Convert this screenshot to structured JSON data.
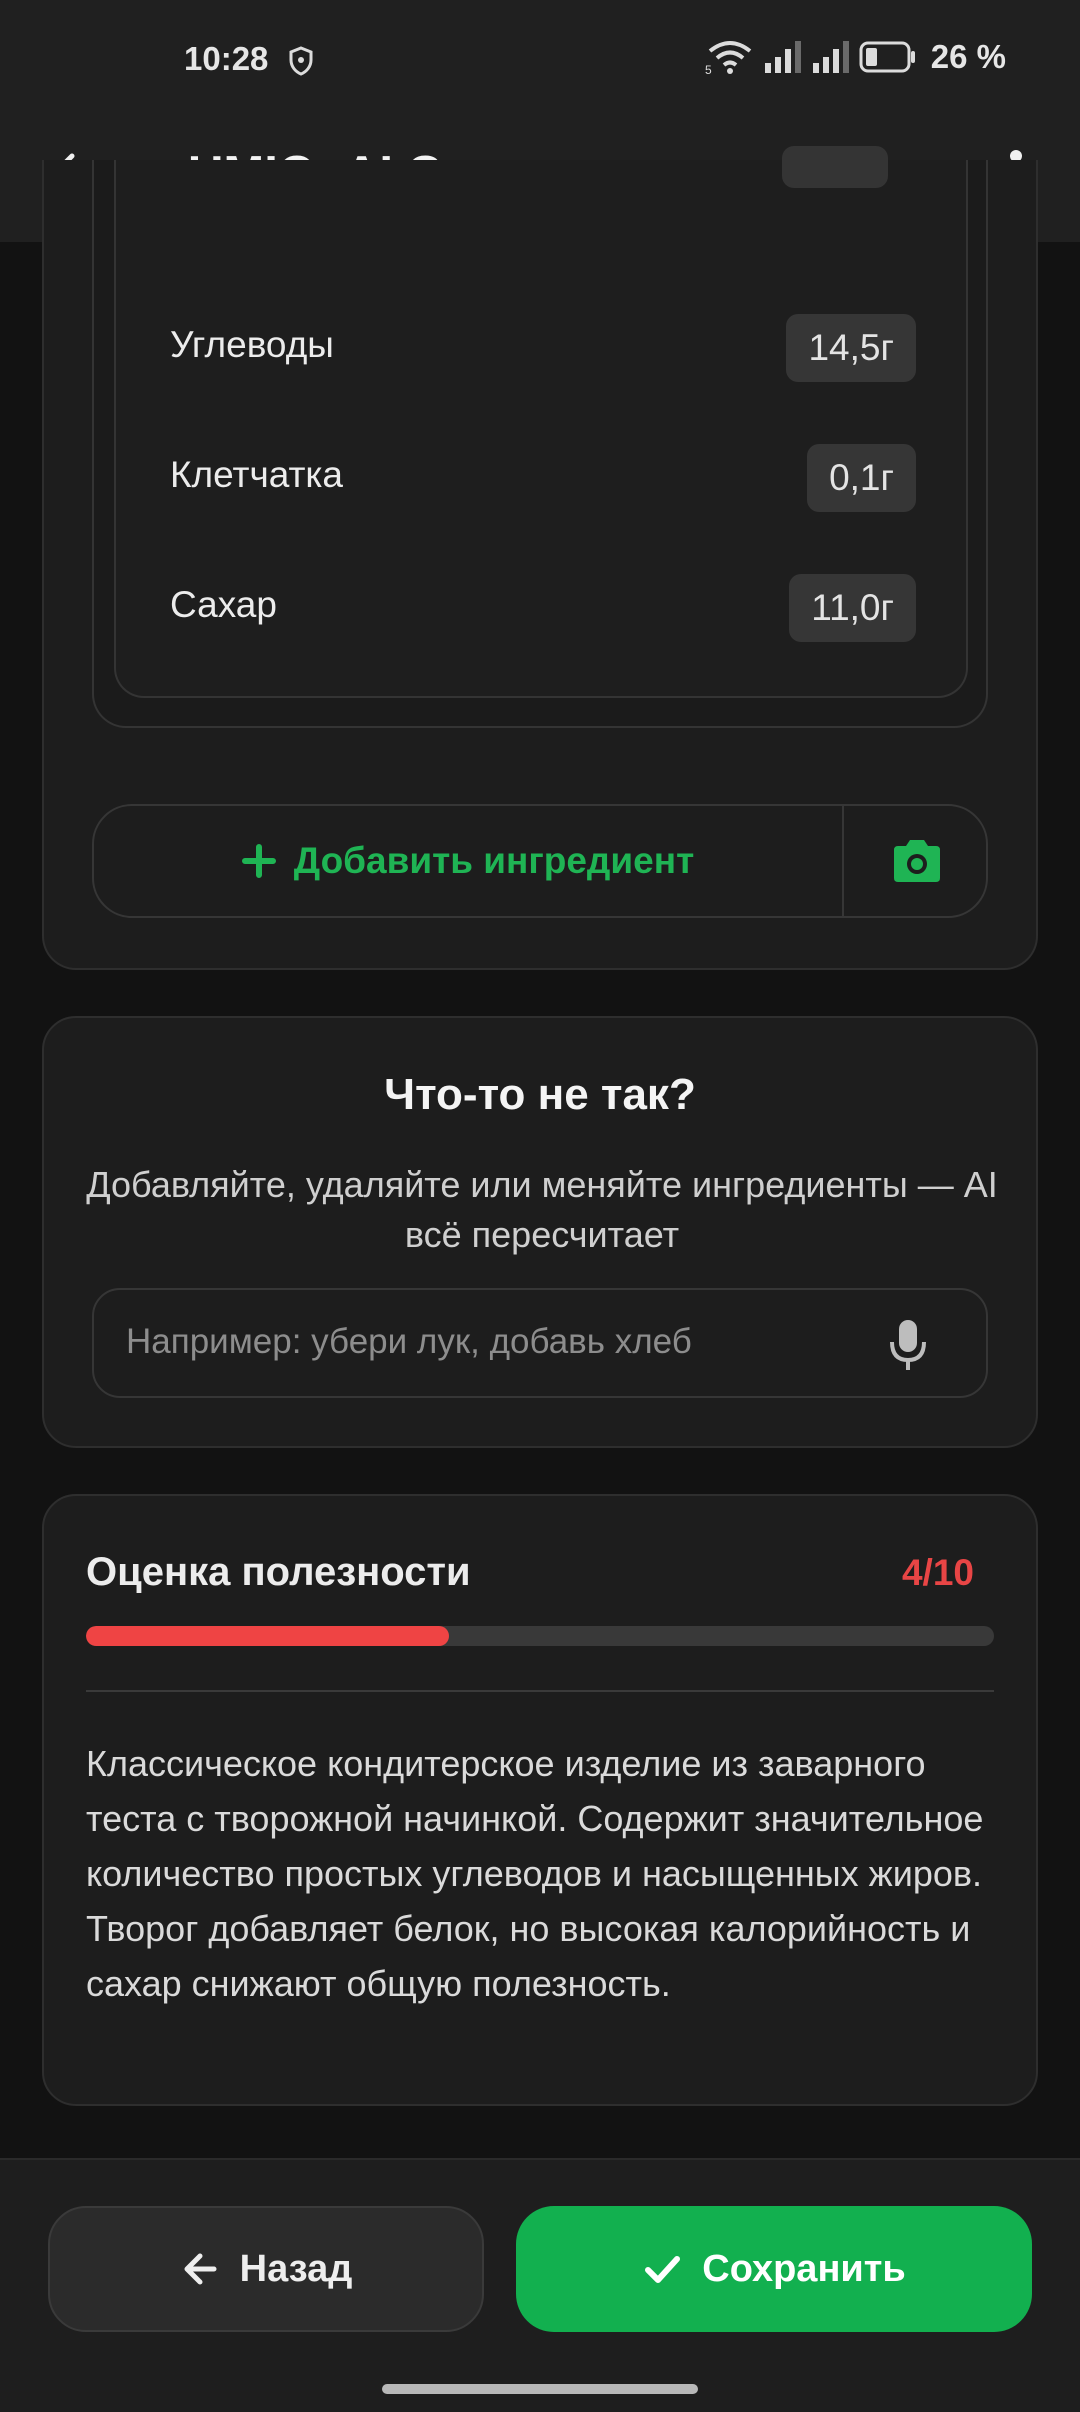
{
  "status_bar": {
    "time": "10:28",
    "battery_percent": "26 %",
    "icons": [
      "shield-icon",
      "wifi-icon",
      "signal-icon",
      "signal-icon",
      "battery-icon"
    ]
  },
  "app_bar": {
    "title": "UMIO: AI Счетчик кало...",
    "icons": [
      "back-arrow-icon",
      "chevron-down-icon",
      "more-vert-icon"
    ]
  },
  "nutrients": [
    {
      "label": "Углеводы",
      "value": "14,5г"
    },
    {
      "label": "Клетчатка",
      "value": "0,1г"
    },
    {
      "label": "Сахар",
      "value": "11,0г"
    }
  ],
  "add_ingredient": {
    "label": "Добавить ингредиент",
    "icons": [
      "plus-icon",
      "camera-icon"
    ]
  },
  "fix_card": {
    "title": "Что-то не так?",
    "subtitle": "Добавляйте, удаляйте или меняйте ингредиенты — AI всё пересчитает",
    "input_placeholder": "Например: убери лук, добавь хлеб",
    "icons": [
      "microphone-icon"
    ]
  },
  "health": {
    "title": "Оценка полезности",
    "score": "4/10",
    "score_fraction": 0.4,
    "description": "Классическое кондитерское изделие из заварного теста с творожной начинкой. Содержит значительное количество простых углеводов и насыщенных жиров. Творог добавляет белок, но высокая калорийность и сахар снижают общую полезность."
  },
  "actions": {
    "back_label": "Назад",
    "save_label": "Сохранить",
    "icons": [
      "arrow-left-icon",
      "check-icon"
    ]
  },
  "colors": {
    "accent_green": "#12b04f",
    "score_red": "#ef4444",
    "background": "#121212",
    "card": "#1d1d1d"
  }
}
